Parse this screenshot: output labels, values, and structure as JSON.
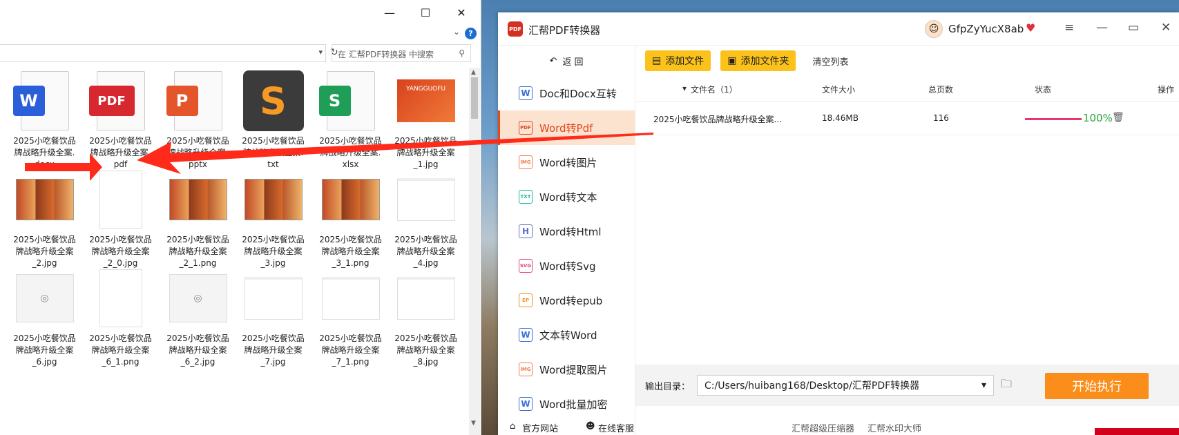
{
  "explorer": {
    "window_buttons": {
      "minimize": "—",
      "maximize": "☐",
      "close": "✕"
    },
    "search_placeholder": "在 汇帮PDF转换器 中搜索",
    "files": [
      [
        "2025小吃餐饮品",
        "牌战略升级全案.",
        "docx"
      ],
      [
        "2025小吃餐饮品",
        "牌战略升级全案.",
        "pdf"
      ],
      [
        "2025小吃餐饮品",
        "牌战略升级全案.",
        "pptx"
      ],
      [
        "2025小吃餐饮品",
        "牌战略升级全案.",
        "txt"
      ],
      [
        "2025小吃餐饮品",
        "牌战略升级全案.",
        "xlsx"
      ],
      [
        "2025小吃餐饮品",
        "牌战略升级全案",
        "_1.jpg"
      ],
      [
        "2025小吃餐饮品",
        "牌战略升级全案",
        "_2.jpg"
      ],
      [
        "2025小吃餐饮品",
        "牌战略升级全案",
        "_2_0.jpg"
      ],
      [
        "2025小吃餐饮品",
        "牌战略升级全案",
        "_2_1.png"
      ],
      [
        "2025小吃餐饮品",
        "牌战略升级全案",
        "_3.jpg"
      ],
      [
        "2025小吃餐饮品",
        "牌战略升级全案",
        "_3_1.png"
      ],
      [
        "2025小吃餐饮品",
        "牌战略升级全案",
        "_4.jpg"
      ],
      [
        "2025小吃餐饮品",
        "牌战略升级全案",
        "_6.jpg"
      ],
      [
        "2025小吃餐饮品",
        "牌战略升级全案",
        "_6_1.png"
      ],
      [
        "2025小吃餐饮品",
        "牌战略升级全案",
        "_6_2.jpg"
      ],
      [
        "2025小吃餐饮品",
        "牌战略升级全案",
        "_7.jpg"
      ],
      [
        "2025小吃餐饮品",
        "牌战略升级全案",
        "_7_1.png"
      ],
      [
        "2025小吃餐饮品",
        "牌战略升级全案",
        "_8.jpg"
      ]
    ],
    "thumb_texts": {
      "pdf": "PDF",
      "w": "W",
      "p": "P",
      "s": "S",
      "slide": "YANGGUOFU"
    }
  },
  "app": {
    "title": "汇帮PDF转换器",
    "logo": "PDF",
    "username": "GfpZyYucX8ab",
    "back": "返  回",
    "sidebar": [
      {
        "label": "Doc和Docx互转",
        "icon": "W",
        "color": "#3b6fd6"
      },
      {
        "label": "Word转Pdf",
        "icon": "PDF",
        "color": "#e0451f",
        "active": true
      },
      {
        "label": "Word转图片",
        "icon": "IMG",
        "color": "#ef7b54"
      },
      {
        "label": "Word转文本",
        "icon": "TXT",
        "color": "#18b7a0"
      },
      {
        "label": "Word转Html",
        "icon": "H",
        "color": "#5b6fc8"
      },
      {
        "label": "Word转Svg",
        "icon": "SVG",
        "color": "#e2457f"
      },
      {
        "label": "Word转epub",
        "icon": "EP",
        "color": "#f08a1e"
      },
      {
        "label": "文本转Word",
        "icon": "W",
        "color": "#3b6fd6"
      },
      {
        "label": "Word提取图片",
        "icon": "IMG",
        "color": "#ef7b54"
      },
      {
        "label": "Word批量加密",
        "icon": "W",
        "color": "#3b6fd6"
      }
    ],
    "toolbar": {
      "add_file": "添加文件",
      "add_folder": "添加文件夹",
      "clear": "清空列表"
    },
    "columns": {
      "name": "文件名（1）",
      "size": "文件大小",
      "pages": "总页数",
      "status": "状态",
      "action": "操作"
    },
    "rows": [
      {
        "name": "2025小吃餐饮品牌战略升级全案...",
        "size": "18.46MB",
        "pages": "116",
        "status": "100%",
        "progress": 1.0
      }
    ],
    "output_label": "输出目录：",
    "output_path": "C:/Users/huibang168/Desktop/汇帮PDF转换器",
    "start": "开始执行",
    "links": {
      "website": "官方网站",
      "support": "在线客服",
      "compress": "汇帮超级压缩器",
      "watermark": "汇帮水印大师"
    }
  }
}
